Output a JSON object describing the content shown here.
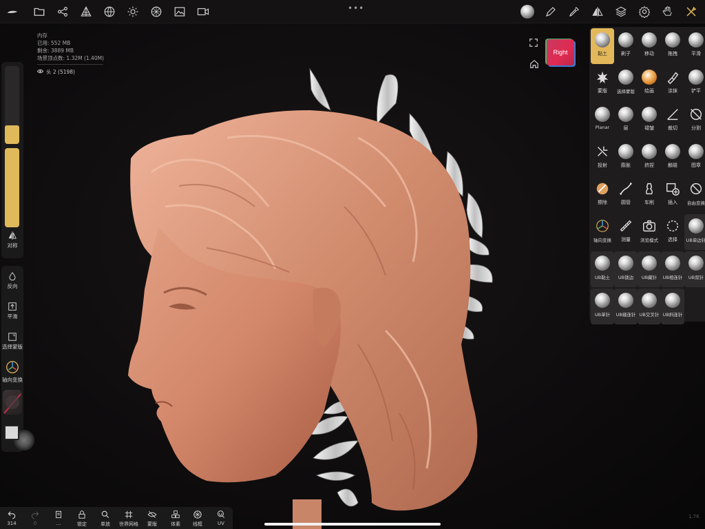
{
  "info": {
    "memory_title": "内存",
    "used": "已用: 552 MB",
    "free": "剩余: 3889 MB",
    "vertices": "场景顶点数: 1.32M (1.40M)",
    "object": "头 2 (5198)"
  },
  "left_toolbar": {
    "symmetry": "对称",
    "invert": "反向",
    "smooth": "平滑",
    "mask": "选择蒙版",
    "gizmo": "轴向变换",
    "size_level": 0.1,
    "intensity_level": 1.0
  },
  "navcube": {
    "label": "Right"
  },
  "tools": [
    {
      "label": "黏土",
      "icon": "clay-ball-icon"
    },
    {
      "label": "刷子",
      "icon": "brush-ball-icon"
    },
    {
      "label": "移动",
      "icon": "move-ball-icon"
    },
    {
      "label": "拖拽",
      "icon": "drag-ball-icon"
    },
    {
      "label": "平滑",
      "icon": "smooth-ball-icon"
    },
    {
      "label": "蒙版",
      "icon": "mask-splat-icon"
    },
    {
      "label": "选择蒙版",
      "icon": "select-mask-ball-icon"
    },
    {
      "label": "绘画",
      "icon": "paint-ball-icon"
    },
    {
      "label": "涂抹",
      "icon": "smudge-icon"
    },
    {
      "label": "铲平",
      "icon": "flatten-ball-icon"
    },
    {
      "label": "Planar",
      "icon": "planar-ball-icon"
    },
    {
      "label": "层",
      "icon": "layer-ball-icon"
    },
    {
      "label": "褶皱",
      "icon": "crease-ball-icon"
    },
    {
      "label": "裁切",
      "icon": "trim-icon"
    },
    {
      "label": "分割",
      "icon": "split-icon"
    },
    {
      "label": "投射",
      "icon": "project-icon"
    },
    {
      "label": "膨胀",
      "icon": "inflate-ball-icon"
    },
    {
      "label": "挤捏",
      "icon": "pinch-ball-icon"
    },
    {
      "label": "触碰",
      "icon": "twist-ball-icon"
    },
    {
      "label": "图章",
      "icon": "stamp-ball-icon"
    },
    {
      "label": "擦除",
      "icon": "eraser-icon"
    },
    {
      "label": "圆管",
      "icon": "tube-icon"
    },
    {
      "label": "车削",
      "icon": "lathe-icon"
    },
    {
      "label": "插入",
      "icon": "insert-icon"
    },
    {
      "label": "自由变换",
      "icon": "transform-icon"
    },
    {
      "label": "轴向变换",
      "icon": "gizmo-icon"
    },
    {
      "label": "测量",
      "icon": "measure-icon"
    },
    {
      "label": "浏览模式",
      "icon": "camera-icon"
    },
    {
      "label": "选择",
      "icon": "select-lasso-icon"
    },
    {
      "label": "UB单边针",
      "icon": "ub-ball-icon"
    },
    {
      "label": "UB黏土",
      "icon": "ub-ball-icon"
    },
    {
      "label": "UB锁边",
      "icon": "ub-ball-icon"
    },
    {
      "label": "UB藏针",
      "icon": "ub-ball-icon"
    },
    {
      "label": "UB相连针",
      "icon": "ub-ball-icon"
    },
    {
      "label": "UB双针",
      "icon": "ub-ball-icon"
    },
    {
      "label": "UB单针",
      "icon": "ub-ball-icon"
    },
    {
      "label": "UB缝连针",
      "icon": "ub-ball-icon"
    },
    {
      "label": "UB交叉针",
      "icon": "ub-ball-icon"
    },
    {
      "label": "UB斜连针",
      "icon": "ub-ball-icon"
    }
  ],
  "bottom_bar": {
    "undo_count": "314",
    "redo_count": "0",
    "more": "...",
    "lock": "锁定",
    "single": "单放",
    "world_grid": "世界网格",
    "mask": "蒙版",
    "voxel": "体素",
    "wireframe": "线框",
    "uv": "UV"
  },
  "version": "1.76",
  "colors": {
    "accent": "#e3b85a",
    "skin": "#d58a6b",
    "panel": "#1e1c1d"
  }
}
